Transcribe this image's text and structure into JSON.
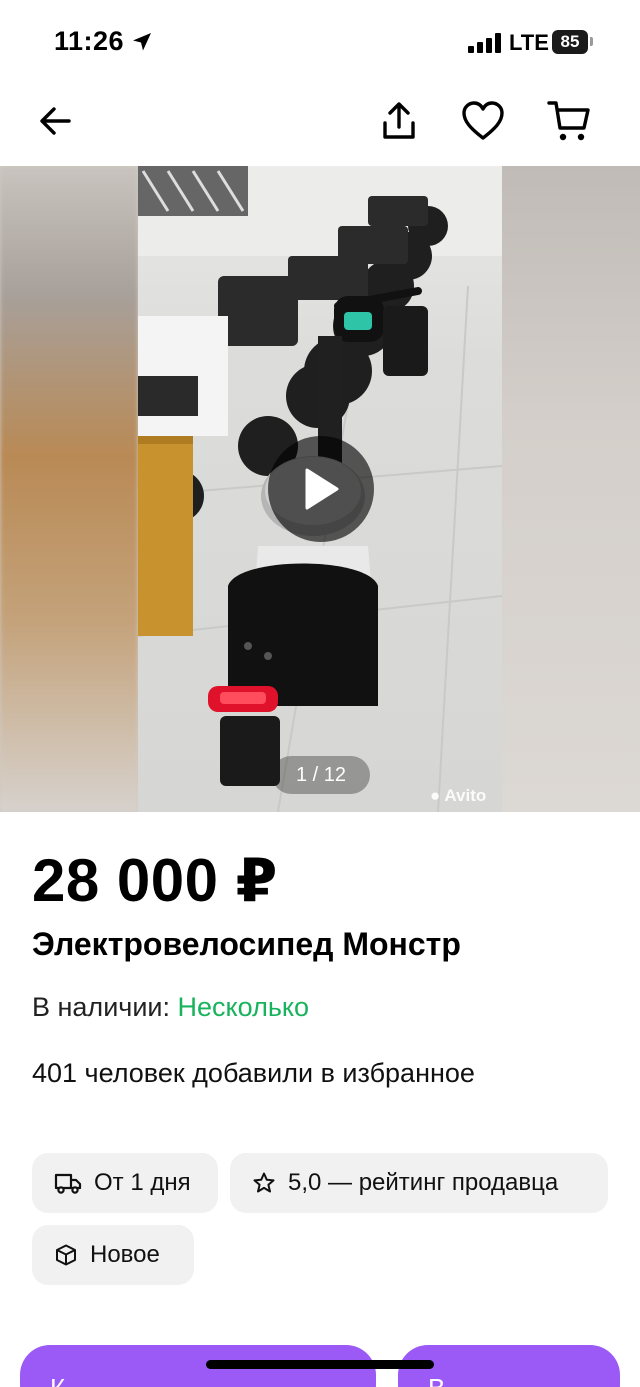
{
  "status_bar": {
    "time": "11:26",
    "network": "LTE",
    "battery": "85",
    "icons": [
      "location-arrow-icon",
      "signal-bars-icon"
    ]
  },
  "top_nav": {
    "icons": [
      "back-arrow-icon",
      "share-icon",
      "heart-icon",
      "cart-icon"
    ]
  },
  "gallery": {
    "counter": "1 / 12",
    "watermark": "Avito",
    "has_video": true
  },
  "product": {
    "price": "28 000 ₽",
    "title": "Электровелосипед Монстр",
    "availability_label": "В наличии:",
    "availability_value": "Несколько",
    "favorites": "401 человек добавили в избранное"
  },
  "chips": {
    "delivery": "От 1 дня",
    "rating": "5,0 — рейтинг продавца",
    "condition": "Новое"
  },
  "bottom_buttons": {
    "primary": "К",
    "secondary": "В"
  },
  "colors": {
    "accent": "#9b59f6",
    "availability": "#19b35d",
    "chip_bg": "#f1f1f1"
  }
}
